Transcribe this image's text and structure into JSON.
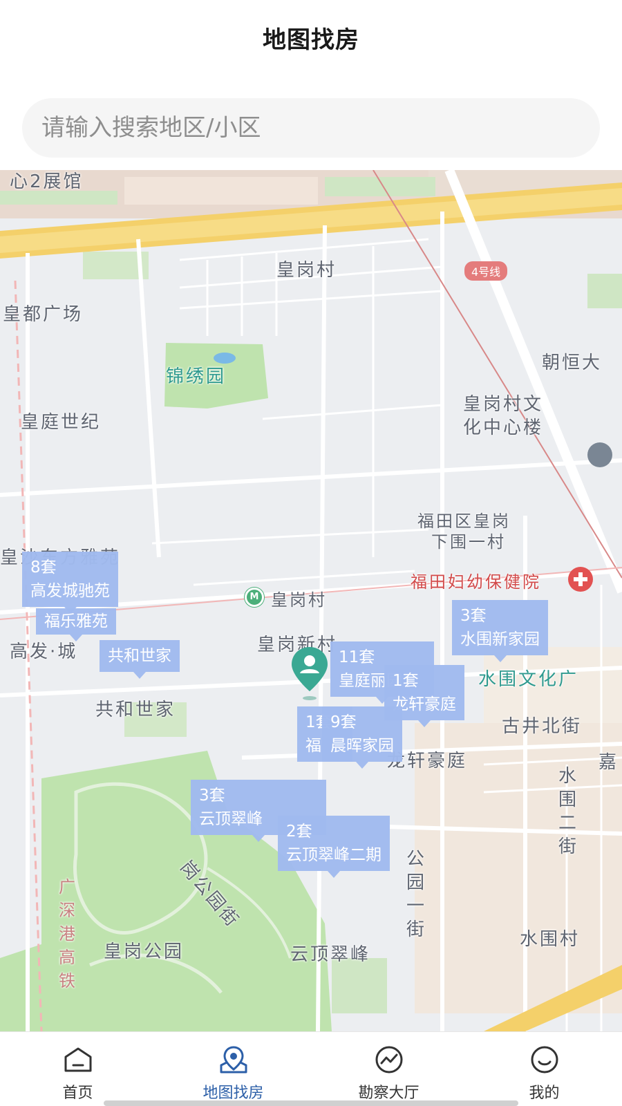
{
  "header": {
    "title": "地图找房"
  },
  "search": {
    "placeholder": "请输入搜索地区/小区"
  },
  "map": {
    "labels": {
      "exhibition": "心2展馆",
      "huanggang_village_top": "皇岗村",
      "huangdu_plaza": "皇都广场",
      "jinxiu_garden": "锦绣园",
      "huangting_century": "皇庭世纪",
      "chaoheng": "朝恒大",
      "culture_center_1": "皇岗村文",
      "culture_center_2": "化中心楼",
      "xiawei_1": "福田区皇岗",
      "xiawei_2": "下围一村",
      "huangsha_yayuan": "皇沙东方雅苑",
      "hospital": "福田妇幼保健院",
      "metro_station": "皇岗村",
      "huanggang_new_village": "皇岗新村",
      "gaofa_cheng": "高发·城",
      "gonghe_shijia": "共和世家",
      "shuiwei_culture": "水围文化广",
      "gujing_north": "古井北街",
      "longxuan_haoting": "龙轩豪庭",
      "shuiwei_second_street": "水围二街",
      "huanggang_park_street": "岗公园街",
      "park_first_street": "公园一街",
      "highspeed_rail": "广深港高铁",
      "huanggang_park": "皇岗公园",
      "yunding_cuifeng": "云顶翠峰",
      "shuiwei_village": "水围村",
      "jia": "嘉"
    },
    "metro_line": "4号线",
    "markers": [
      {
        "count": "8套",
        "name": "高发城驰苑"
      },
      {
        "count": "",
        "name": "福乐雅苑"
      },
      {
        "count": "",
        "name": "共和世家"
      },
      {
        "count": "3套",
        "name": "水围新家园"
      },
      {
        "count": "11套",
        "name": "皇庭丽园"
      },
      {
        "count": "1套",
        "name": "龙轩豪庭"
      },
      {
        "count": "1套",
        "name": "福"
      },
      {
        "count": "9套",
        "name": "晨晖家园"
      },
      {
        "count": "3套",
        "name": "云顶翠峰"
      },
      {
        "count": "2套",
        "name": "云顶翠峰二期"
      }
    ]
  },
  "tabbar": {
    "items": [
      {
        "label": "首页",
        "icon": "home-icon"
      },
      {
        "label": "地图找房",
        "icon": "map-pin-icon"
      },
      {
        "label": "勘察大厅",
        "icon": "trend-icon"
      },
      {
        "label": "我的",
        "icon": "smile-icon"
      }
    ],
    "active_color": "#2c5fa8"
  }
}
